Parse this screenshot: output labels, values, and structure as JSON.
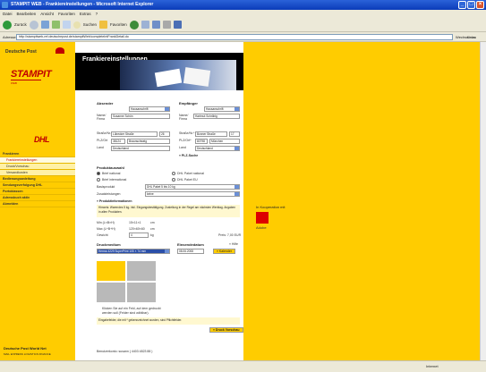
{
  "window": {
    "title": "STAMPIT WEB - Frankiereinstellungen - Microsoft Internet Explorer"
  },
  "menu": [
    "Datei",
    "Bearbeiten",
    "Ansicht",
    "Favoriten",
    "Extras",
    "?"
  ],
  "toolbar": {
    "back": "Zurück",
    "search": "Suchen",
    "favorites": "Favoriten"
  },
  "address": {
    "label": "Adresse",
    "url": "http://stampitweb-ref.deutschepost.de/stampitWeb/completeIntFrankDetail.do",
    "go": "Wechseln zu",
    "links": "Links"
  },
  "sidebar": {
    "brand": "Deutsche Post",
    "stampit": "STAMPIT",
    "stampit_sub": "WEB",
    "dhl": "DHL",
    "nav": [
      {
        "label": "Frankieren",
        "type": "head"
      },
      {
        "label": "Frankiereinstellungen",
        "type": "sub active"
      },
      {
        "label": "Druck/Vorschau",
        "type": "sub"
      },
      {
        "label": "Versandkosten",
        "type": "sub"
      },
      {
        "label": "Bedienungsanleitung",
        "type": "head"
      },
      {
        "label": "Sendungsverfolgung DHL",
        "type": "head"
      },
      {
        "label": "Portoklassen",
        "type": "head"
      },
      {
        "label": "Adressbuch aktiv",
        "type": "head"
      },
      {
        "label": "Abmelden",
        "type": "head"
      }
    ],
    "footer_brand": "Deutsche Post World Net",
    "footer_sub": "MAIL EXPRESS LOGISTICS FINANCE"
  },
  "main": {
    "title": "Frankiereinstellungen",
    "sender": {
      "heading": "Absender",
      "type_value": "Hausanschrift",
      "name_label": "Name/ Firma",
      "name_value": "Susanne Schön",
      "street_label": "Straße/Nr.",
      "street_value": "Lübecker Straße",
      "house_value": "26",
      "zip_label": "PLZ/Ort",
      "zip_value": "38124",
      "city_value": "Braunschweig",
      "country_label": "Land",
      "country_value": "Deutschland"
    },
    "recipient": {
      "heading": "Empfänger",
      "type_value": "Hausanschrift",
      "name_label": "Name/ Firma",
      "name_value": "Hartmut Schröbig",
      "street_label": "Straße/Nr.*",
      "street_value": "Bonner Straße",
      "house_value": "17",
      "zip_label": "PLZ/Ort*",
      "zip_value": "80798",
      "city_value": "München",
      "country_label": "Land",
      "country_value": "Deutschland",
      "plz_link": "» PLZ-Suche"
    },
    "product": {
      "heading": "Produktauswahl",
      "options": [
        {
          "label": "Brief national",
          "checked": true
        },
        {
          "label": "DHL Paket national",
          "checked": false
        },
        {
          "label": "Brief international",
          "checked": false
        },
        {
          "label": "DHL Paket EU",
          "checked": false
        }
      ],
      "base_label": "Basisprodukt",
      "base_value": "DHL Paket 5 bis 10 kg",
      "extra_label": "Zusatzleistungen",
      "extra_value": "keine"
    },
    "info": {
      "heading": "» Produktinformationen",
      "text": "Hinweis: Warendes 5 kg. inkl. Eingangsbestätigung. Zustellung in der Regel am nächsten Werktag. Angaben in allen Produkten.",
      "min_label": "Min (L×B×H)",
      "min_value": "15×11×1",
      "max_label": "Max (L+B+H)",
      "max_value": "120×60×60",
      "weight_label": "Gewicht",
      "weight_value": "4",
      "weight_unit": "kg",
      "price": "Preis: 7,00 EUR",
      "unit": "cm"
    },
    "print": {
      "heading": "Druckmedium",
      "value": "Herma 4229 SuperPrint 105 × 74 mm",
      "date_heading": "Einsendedatum",
      "date_value": "08.06.2008",
      "help": "» Hilfe",
      "calendar": "» Kalender"
    },
    "note": "Klicken Sie auf ein Feld, auf dem gedruckt werden soll (Felder sind wählbar).",
    "confirm": "Eingabefelder, die mit * gekennzeichnet wurden, sind Pflichtfelder.",
    "print_button": "» Druck Vorschau",
    "balance": "Benutzerkonto: susann ( 4403 4823 88 )"
  },
  "right": {
    "coop": "In Kooperation mit",
    "adobe": "Adobe"
  },
  "status": {
    "internet": "Internet"
  }
}
